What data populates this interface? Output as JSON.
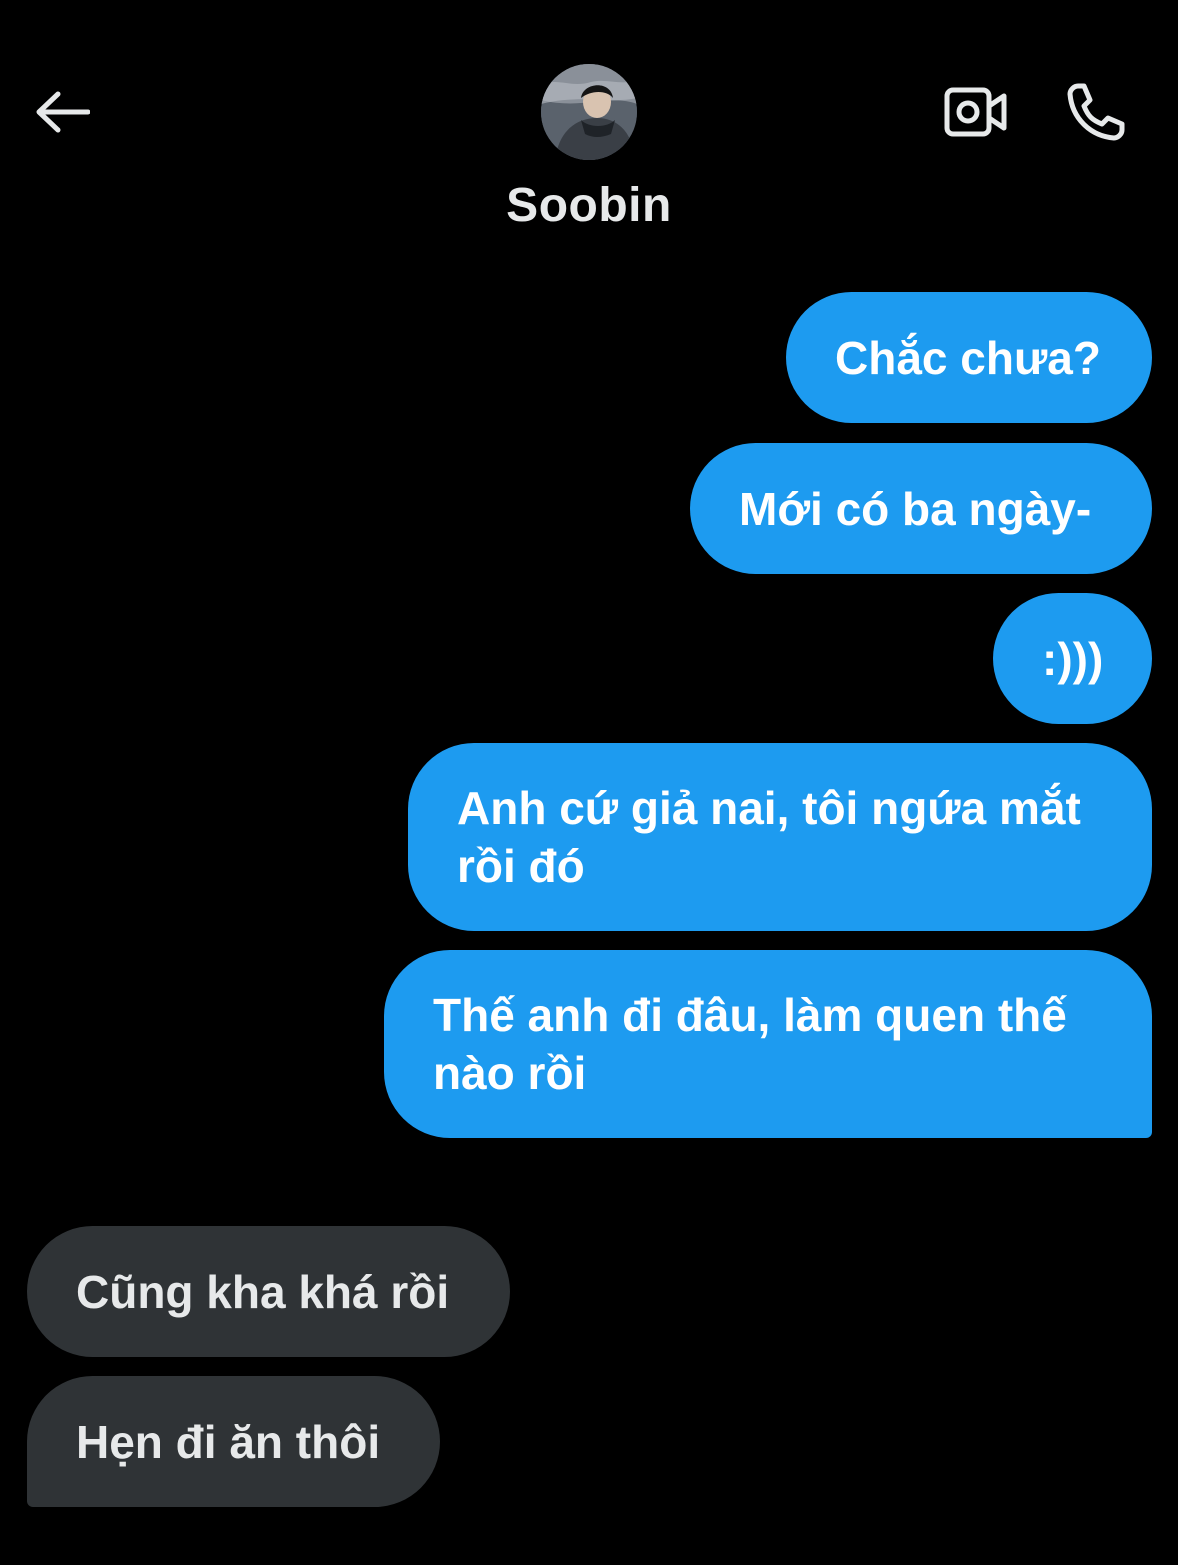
{
  "header": {
    "contact_name": "Soobin",
    "back_icon": "arrow-left-icon",
    "video_icon": "video-camera-icon",
    "call_icon": "phone-icon"
  },
  "colors": {
    "background": "#000000",
    "sent_bubble": "#1d9bf0",
    "received_bubble": "#2f3336"
  },
  "messages": [
    {
      "direction": "sent",
      "text": "Chắc chưa?"
    },
    {
      "direction": "sent",
      "text": "Mới có ba ngày-"
    },
    {
      "direction": "sent",
      "text": ":)))"
    },
    {
      "direction": "sent",
      "text": "Anh cứ giả nai, tôi ngứa mắt rồi đó"
    },
    {
      "direction": "sent",
      "text": "Thế anh đi đâu, làm quen thế nào rồi"
    },
    {
      "direction": "received",
      "text": "Cũng kha khá rồi"
    },
    {
      "direction": "received",
      "text": "Hẹn đi ăn thôi"
    }
  ]
}
